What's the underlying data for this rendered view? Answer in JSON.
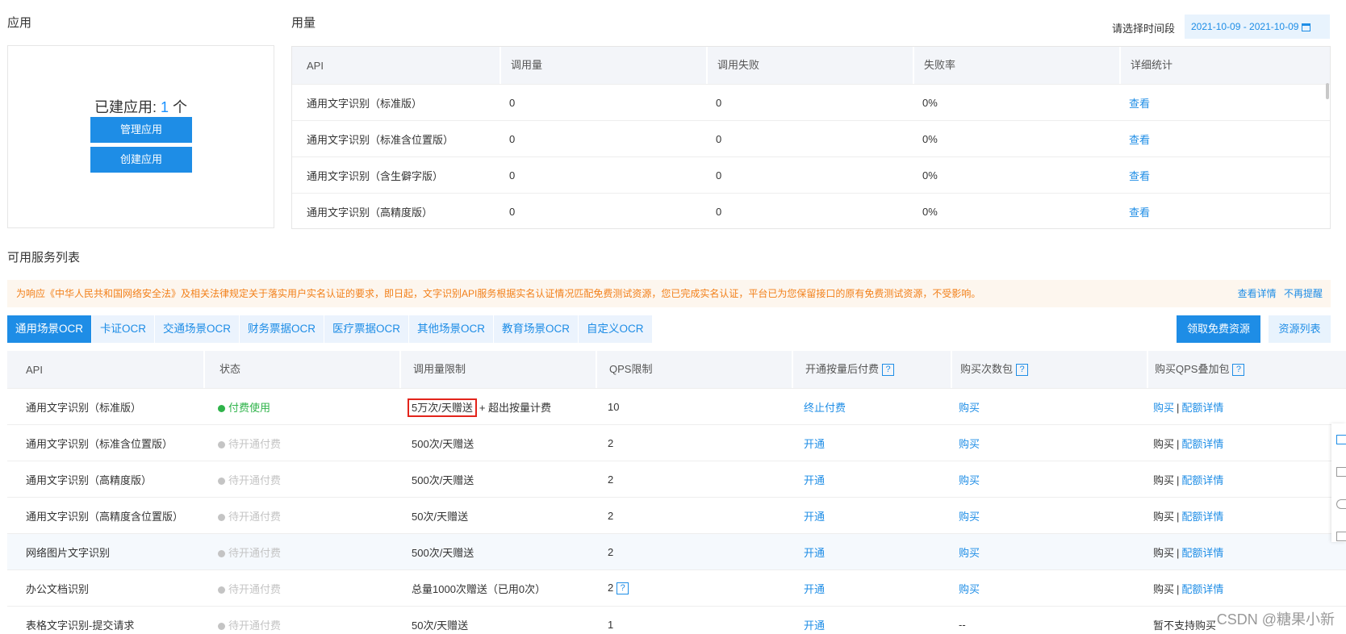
{
  "apps": {
    "section_title": "应用",
    "created_prefix": "已建应用: ",
    "created_count": "1",
    "created_suffix": " 个",
    "manage_button": "管理应用",
    "create_button": "创建应用"
  },
  "usage": {
    "section_title": "用量",
    "date_label": "请选择时间段",
    "date_range": "2021-10-09 - 2021-10-09",
    "columns": [
      "API",
      "调用量",
      "调用失败",
      "失败率",
      "详细统计"
    ],
    "rows": [
      {
        "api": "通用文字识别（标准版）",
        "calls": "0",
        "failed": "0",
        "rate": "0%",
        "detail": "查看"
      },
      {
        "api": "通用文字识别（标准含位置版）",
        "calls": "0",
        "failed": "0",
        "rate": "0%",
        "detail": "查看"
      },
      {
        "api": "通用文字识别（含生僻字版）",
        "calls": "0",
        "failed": "0",
        "rate": "0%",
        "detail": "查看"
      },
      {
        "api": "通用文字识别（高精度版）",
        "calls": "0",
        "failed": "0",
        "rate": "0%",
        "detail": "查看"
      }
    ]
  },
  "services": {
    "section_title": "可用服务列表",
    "notice": "为响应《中华人民共和国网络安全法》及相关法律规定关于落实用户实名认证的要求，即日起，文字识别API服务根据实名认证情况匹配免费测试资源，您已完成实名认证，平台已为您保留接口的原有免费测试资源，不受影响。",
    "notice_detail_link": "查看详情",
    "notice_dismiss_link": "不再提醒",
    "tabs": [
      "通用场景OCR",
      "卡证OCR",
      "交通场景OCR",
      "财务票据OCR",
      "医疗票据OCR",
      "其他场景OCR",
      "教育场景OCR",
      "自定义OCR"
    ],
    "free_button": "领取免费资源",
    "resource_button": "资源列表",
    "columns": [
      "API",
      "状态",
      "调用量限制",
      "QPS限制",
      "开通按量后付费",
      "购买次数包",
      "购买QPS叠加包"
    ],
    "help_mark": "?",
    "rows": [
      {
        "api": "通用文字识别（标准版）",
        "status": "付费使用",
        "paid": true,
        "limit": "5万次/天赠送",
        "limit_extra": "+ 超出按量计费",
        "qps": "10",
        "postpay": "终止付费",
        "pack": "购买",
        "qps_buy": "购买",
        "qps_sep": "|",
        "qps_detail": "配额详情"
      },
      {
        "api": "通用文字识别（标准含位置版）",
        "status": "待开通付费",
        "paid": false,
        "limit": "500次/天赠送",
        "limit_extra": "",
        "qps": "2",
        "postpay": "开通",
        "pack": "购买",
        "qps_buy": "购买",
        "qps_sep": "|",
        "qps_detail": "配额详情"
      },
      {
        "api": "通用文字识别（高精度版）",
        "status": "待开通付费",
        "paid": false,
        "limit": "500次/天赠送",
        "limit_extra": "",
        "qps": "2",
        "postpay": "开通",
        "pack": "购买",
        "qps_buy": "购买",
        "qps_sep": "|",
        "qps_detail": "配额详情"
      },
      {
        "api": "通用文字识别（高精度含位置版）",
        "status": "待开通付费",
        "paid": false,
        "limit": "50次/天赠送",
        "limit_extra": "",
        "qps": "2",
        "postpay": "开通",
        "pack": "购买",
        "qps_buy": "购买",
        "qps_sep": "|",
        "qps_detail": "配额详情"
      },
      {
        "api": "网络图片文字识别",
        "status": "待开通付费",
        "paid": false,
        "limit": "500次/天赠送",
        "limit_extra": "",
        "qps": "2",
        "postpay": "开通",
        "pack": "购买",
        "qps_buy": "购买",
        "qps_sep": "|",
        "qps_detail": "配额详情"
      },
      {
        "api": "办公文档识别",
        "status": "待开通付费",
        "paid": false,
        "limit": "总量1000次赠送（已用0次）",
        "limit_extra": "",
        "qps": "2",
        "postpay": "开通",
        "pack": "购买",
        "qps_buy": "购买",
        "qps_sep": "|",
        "qps_detail": "配额详情"
      },
      {
        "api": "表格文字识别-提交请求",
        "status": "待开通付费",
        "paid": false,
        "limit": "50次/天赠送",
        "limit_extra": "",
        "qps": "1",
        "postpay": "开通",
        "pack": "--",
        "qps_buy": "暂不支持购买",
        "qps_sep": "",
        "qps_detail": ""
      }
    ]
  },
  "watermark": "CSDN @糖果小新",
  "colors": {
    "accent": "#1e8de6",
    "paid": "#2fb34a",
    "notice": "#f2801a",
    "highlight_box": "#e3241b"
  }
}
